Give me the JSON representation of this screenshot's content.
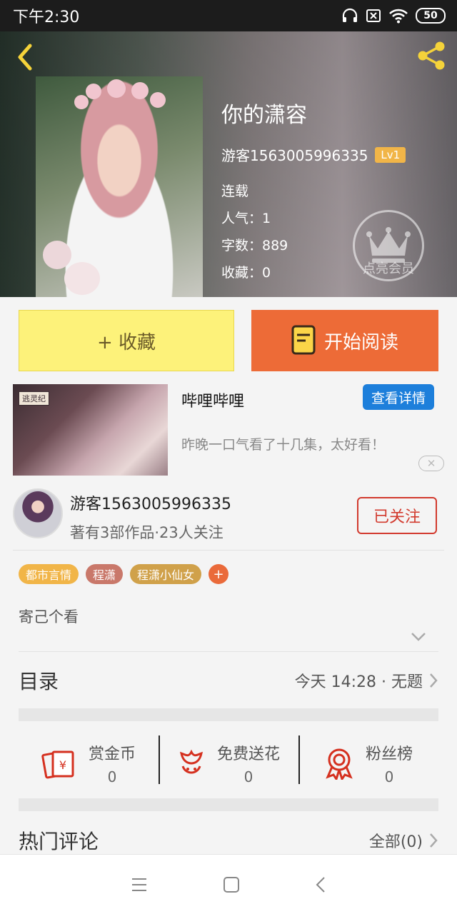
{
  "status_bar": {
    "time": "下午2:30",
    "battery": "50"
  },
  "book": {
    "title": "你的潇容",
    "author_name": "游客1563005996335",
    "level": "Lv1",
    "status": "连载",
    "popularity": "人气：1",
    "word_count": "字数：889",
    "favorites": "收藏：0",
    "vip_label": "点亮会员"
  },
  "actions": {
    "collect_label": "+ 收藏",
    "read_label": "开始阅读"
  },
  "ad": {
    "title": "哔哩哔哩",
    "detail_button": "查看详情",
    "description": "昨晚一口气看了十几集，太好看！",
    "image_tag": "逃灵纪",
    "close": "✕"
  },
  "author_card": {
    "name": "游客1563005996335",
    "subtitle": "著有3部作品·23人关注",
    "follow_label": "已关注"
  },
  "tags": [
    {
      "label": "都市言情",
      "color": "#f1b548"
    },
    {
      "label": "程潇",
      "color": "#c9786a"
    },
    {
      "label": "程潇小仙女",
      "color": "#d0a14a"
    }
  ],
  "tag_add": "+",
  "description": "寄己个看",
  "catalog": {
    "title": "目录",
    "latest": "今天 14:28 · 无题"
  },
  "stats": [
    {
      "label": "赏金币",
      "value": "0",
      "icon": "red-envelope-icon"
    },
    {
      "label": "免费送花",
      "value": "0",
      "icon": "flower-icon"
    },
    {
      "label": "粉丝榜",
      "value": "0",
      "icon": "medal-icon"
    }
  ],
  "comments": {
    "title": "热门评论",
    "all_label": "全部(0)"
  },
  "colors": {
    "accent_orange": "#ed6b37",
    "collect_yellow": "#fdf27a",
    "follow_red": "#d23a2e",
    "ad_blue": "#1d7fdb",
    "icon_red": "#d5301f"
  }
}
